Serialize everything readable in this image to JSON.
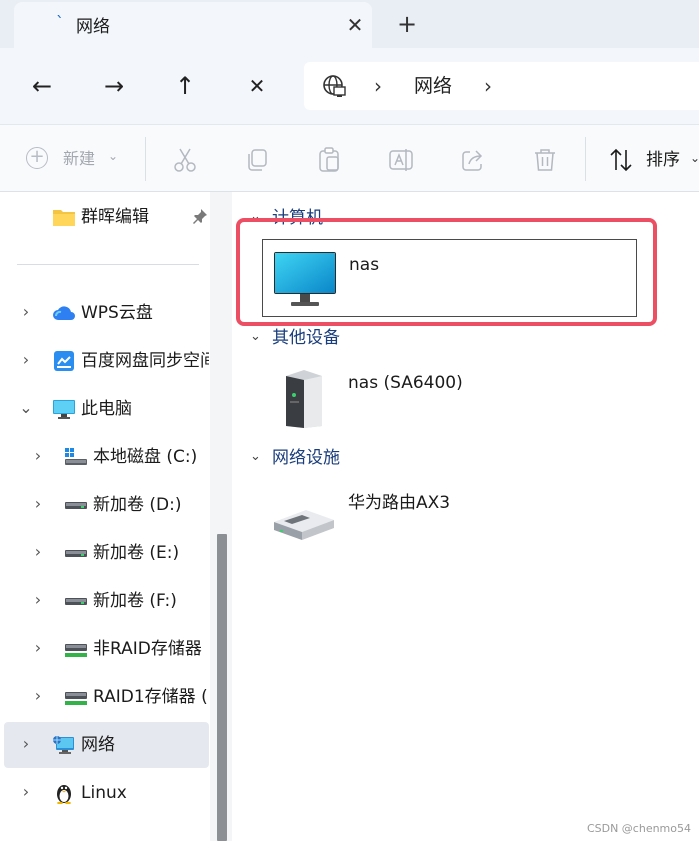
{
  "tab": {
    "title": "网络",
    "close": "✕",
    "new_tab": "+"
  },
  "nav": {
    "back": "←",
    "forward": "→",
    "up": "↑",
    "cancel": "✕"
  },
  "address": {
    "chevron1": "›",
    "location": "网络",
    "chevron2": "›"
  },
  "commands": {
    "new_label": "新建",
    "dropdown": "⌄",
    "sort_label": "排序",
    "sort_dropdown": "⌄"
  },
  "sidebar": {
    "items": [
      {
        "label": "群晖编辑",
        "icon": "folder-icon"
      },
      {
        "label": "WPS云盘",
        "icon": "cloud-icon"
      },
      {
        "label": "百度网盘同步空间",
        "icon": "baidu-netdisk-icon"
      },
      {
        "label": "此电脑",
        "icon": "this-pc-icon"
      },
      {
        "label": "本地磁盘 (C:)",
        "icon": "windows-drive-icon"
      },
      {
        "label": "新加卷 (D:)",
        "icon": "drive-icon"
      },
      {
        "label": "新加卷 (E:)",
        "icon": "drive-icon"
      },
      {
        "label": "新加卷 (F:)",
        "icon": "drive-icon"
      },
      {
        "label": "非RAID存储器",
        "icon": "network-drive-icon"
      },
      {
        "label": "RAID1存储器 (",
        "icon": "network-drive-icon"
      },
      {
        "label": "网络",
        "icon": "network-icon"
      },
      {
        "label": "Linux",
        "icon": "linux-penguin-icon"
      }
    ]
  },
  "groups": {
    "computer": {
      "label": "计算机",
      "items": [
        {
          "name": "nas",
          "icon": "monitor-icon"
        }
      ]
    },
    "other": {
      "label": "其他设备",
      "items": [
        {
          "name": "nas (SA6400)",
          "icon": "server-icon"
        }
      ]
    },
    "network_infra": {
      "label": "网络设施",
      "items": [
        {
          "name": "华为路由AX3",
          "icon": "router-icon"
        }
      ]
    }
  },
  "chevrons": {
    "right": "›",
    "down": "⌄"
  },
  "colors": {
    "highlight": "#ec4f63",
    "accent": "#1b6ac9"
  },
  "watermark": "CSDN @chenmo54"
}
